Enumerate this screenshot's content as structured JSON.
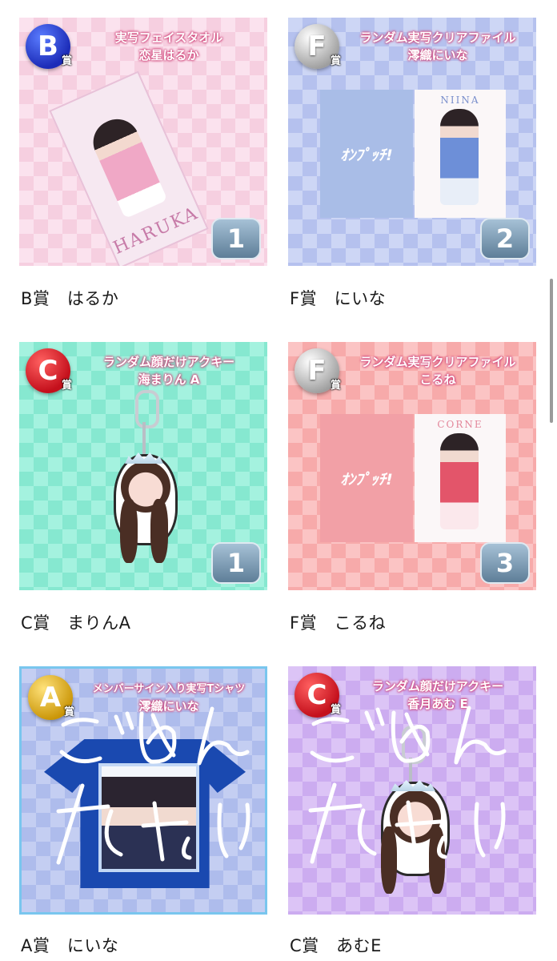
{
  "items": [
    {
      "label": "B賞　はるか",
      "rank_letter": "B",
      "rank_suffix": "賞",
      "title_line1": "実写フェイスタオル",
      "title_line2": "恋星はるか",
      "count": "1",
      "product_print": "HARUKA",
      "badge_color": "#1c2cb8",
      "bg_colors": [
        "#fbe2ee",
        "#f6cfe0"
      ]
    },
    {
      "label": "F賞　にいな",
      "rank_letter": "F",
      "rank_suffix": "賞",
      "title_line1": "ランダム実写クリアファイル",
      "title_line2": "澪織にいな",
      "count": "2",
      "product_print": "NIINA",
      "logo_text": "ｵﾝﾌﾟｯﾁ!",
      "badge_color": "#9e9e9e",
      "bg_colors": [
        "#cdd6f5",
        "#b5c1ee"
      ]
    },
    {
      "label": "C賞　まりんA",
      "rank_letter": "C",
      "rank_suffix": "賞",
      "title_line1": "ランダム顔だけアクキー",
      "title_line2": "海まりん A",
      "count": "1",
      "badge_color": "#c4101c",
      "bg_colors": [
        "#a4f2df",
        "#86e8d0"
      ]
    },
    {
      "label": "F賞　こるね",
      "rank_letter": "F",
      "rank_suffix": "賞",
      "title_line1": "ランダム実写クリアファイル",
      "title_line2": "こるね",
      "count": "3",
      "product_print": "CORNE",
      "logo_text": "ｵﾝﾌﾟｯﾁ!",
      "badge_color": "#9e9e9e",
      "bg_colors": [
        "#fbc4c4",
        "#f7aaaa"
      ]
    },
    {
      "label": "A賞　にいな",
      "rank_letter": "A",
      "rank_suffix": "賞",
      "title_line1": "メンバーサイン入り実写Tシャツ",
      "title_line2": "澪織にいな",
      "badge_color": "#c99405",
      "bg_colors": [
        "#c4cef2",
        "#aebcec"
      ],
      "selected": true,
      "overlay_text": "ごめんなさい"
    },
    {
      "label": "C賞　あむE",
      "rank_letter": "C",
      "rank_suffix": "賞",
      "title_line1": "ランダム顔だけアクキー",
      "title_line2": "香月あむ E",
      "badge_color": "#c4101c",
      "bg_colors": [
        "#dcc4f6",
        "#ccacf0"
      ],
      "overlay_text": "ごめんなさい"
    }
  ]
}
